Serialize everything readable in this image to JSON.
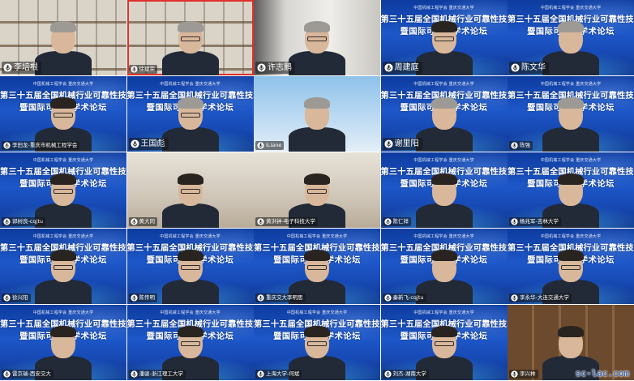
{
  "tiles": [
    {
      "name": "李培根",
      "bg": "shelf",
      "big": true,
      "active": false
    },
    {
      "name": "徐建荣",
      "bg": "shelf",
      "big": false,
      "active": true
    },
    {
      "name": "许志鹏",
      "bg": "wall",
      "big": true,
      "active": false
    },
    {
      "name": "周建庭",
      "bg": "conf",
      "big": true,
      "active": false
    },
    {
      "name": "陈文华",
      "bg": "conf",
      "big": true,
      "active": false
    },
    {
      "name": "李田龙-重庆市机械工程学会",
      "bg": "conf",
      "big": false,
      "active": false
    },
    {
      "name": "王国彪",
      "bg": "conf",
      "big": true,
      "active": false
    },
    {
      "name": "iLiane",
      "bg": "sky",
      "big": false,
      "active": false
    },
    {
      "name": "谢里阳",
      "bg": "conf",
      "big": true,
      "active": false
    },
    {
      "name": "陈强",
      "bg": "conf",
      "big": false,
      "active": false
    },
    {
      "name": "郭树良-cqjtu",
      "bg": "conf",
      "big": false,
      "active": false
    },
    {
      "name": "黄大同",
      "bg": "room",
      "big": false,
      "active": false
    },
    {
      "name": "黄洪钟-电子科技大学",
      "bg": "room",
      "big": false,
      "active": false
    },
    {
      "name": "陈仁祥",
      "bg": "conf",
      "big": false,
      "active": false
    },
    {
      "name": "杨兆军-吉林大学",
      "bg": "conf",
      "big": false,
      "active": false
    },
    {
      "name": "徐兴阳",
      "bg": "conf",
      "big": false,
      "active": false
    },
    {
      "name": "陈传明",
      "bg": "conf",
      "big": false,
      "active": false
    },
    {
      "name": "重庆交大李明思",
      "bg": "conf",
      "big": false,
      "active": false
    },
    {
      "name": "秦新飞-cqjtu",
      "bg": "conf",
      "big": false,
      "active": false
    },
    {
      "name": "李永华-大连交通大学",
      "bg": "conf",
      "big": false,
      "active": false
    },
    {
      "name": "雷京瑞-西安交大",
      "bg": "conf",
      "big": false,
      "active": false
    },
    {
      "name": "潘骏-浙江理工大学",
      "bg": "conf",
      "big": false,
      "active": false
    },
    {
      "name": "上海大学-何斌",
      "bg": "conf",
      "big": false,
      "active": false
    },
    {
      "name": "刘杰-湖南大学",
      "bg": "conf",
      "big": false,
      "active": false
    },
    {
      "name": "李兴林",
      "bg": "wood",
      "big": false,
      "active": false
    }
  ],
  "banner": {
    "logos": "中国机械工程学会   重庆交通大学",
    "line1": "第三十五届全国机械行业可靠性技术学术年会",
    "line2": "暨国际可靠性学术论坛"
  },
  "watermark": "sc-lac.com",
  "colors": {
    "active_border": "#e0302a",
    "conference_blue": "#1d57c8"
  }
}
